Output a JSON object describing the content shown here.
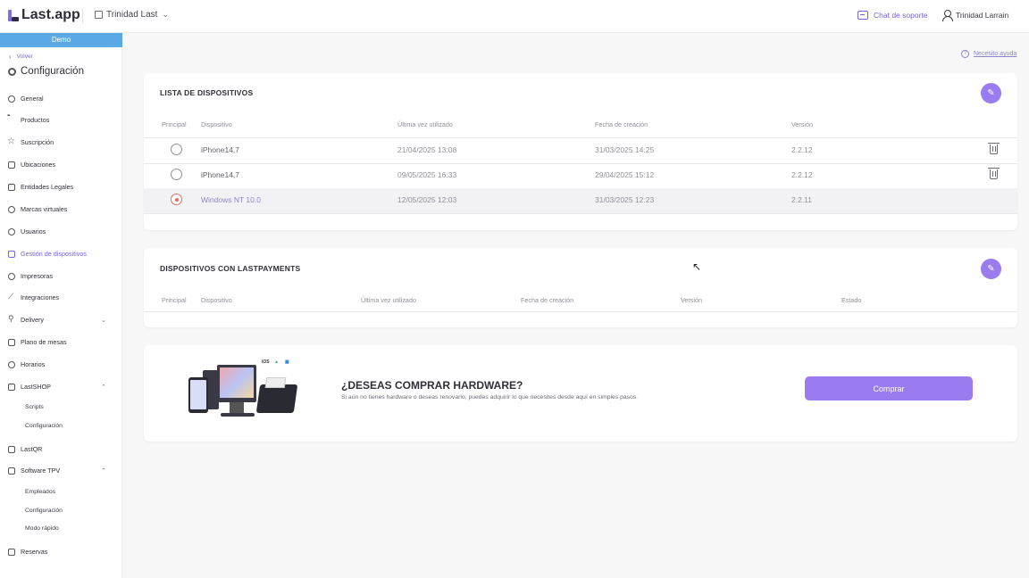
{
  "header": {
    "logo": "Last.app",
    "store": "Trinidad Last",
    "support": "Chat de soporte",
    "user": "Trinidad Larrain"
  },
  "sidebar": {
    "demo": "Demo",
    "back": "Volver",
    "title": "Configuración",
    "items": [
      {
        "label": "General",
        "icon": "gear-icon"
      },
      {
        "label": "Productos",
        "icon": "grid-icon"
      },
      {
        "label": "Suscripción",
        "icon": "star-icon"
      },
      {
        "label": "Ubicaciones",
        "icon": "store-icon"
      },
      {
        "label": "Entidades Legales",
        "icon": "document-icon"
      },
      {
        "label": "Marcas virtuales",
        "icon": "brand-icon"
      },
      {
        "label": "Usuarios",
        "icon": "user-icon"
      },
      {
        "label": "Gestión de dispositivos",
        "icon": "device-icon"
      },
      {
        "label": "Impresoras",
        "icon": "printer-icon"
      },
      {
        "label": "Integraciones",
        "icon": "plug-icon"
      },
      {
        "label": "Delivery",
        "icon": "bike-icon"
      },
      {
        "label": "Plano de mesas",
        "icon": "table-icon"
      },
      {
        "label": "Horarios",
        "icon": "clock-icon"
      },
      {
        "label": "LastSHOP",
        "icon": "shop-icon"
      },
      {
        "label": "LastQR",
        "icon": "qr-icon"
      },
      {
        "label": "Software TPV",
        "icon": "monitor-icon"
      },
      {
        "label": "Reservas",
        "icon": "calendar-icon"
      }
    ],
    "lastshop_sub": [
      "Scripts",
      "Configuración"
    ],
    "tpv_sub": [
      "Empleados",
      "Configuración",
      "Modo rápido"
    ]
  },
  "help": "Necesito ayuda",
  "devices": {
    "title": "LISTA DE DISPOSITIVOS",
    "columns": [
      "Principal",
      "Dispositivo",
      "Última vez utilizado",
      "Fecha de creación",
      "Versión"
    ],
    "rows": [
      {
        "device": "iPhone14,7",
        "last_used": "21/04/2025 13:08",
        "created": "31/03/2025 14:25",
        "version": "2.2.12",
        "principal": false
      },
      {
        "device": "iPhone14,7",
        "last_used": "09/05/2025 16:33",
        "created": "29/04/2025 15:12",
        "version": "2.2.12",
        "principal": false
      },
      {
        "device": "Windows NT 10.0",
        "last_used": "12/05/2025 12:03",
        "created": "31/03/2025 12:23",
        "version": "2.2.11",
        "principal": true
      }
    ]
  },
  "lastpayments": {
    "title": "DISPOSITIVOS CON LASTPAYMENTS",
    "columns": [
      "Principal",
      "Dispositivo",
      "Última vez utilizado",
      "Fecha de creación",
      "Versión",
      "Estado"
    ]
  },
  "hardware": {
    "title": "¿DESEAS COMPRAR HARDWARE?",
    "desc": "Si aún no tienes hardware o deseas renovarlo, puedes adquirir lo que necesites desde aquí en simples pasos.",
    "button": "Comprar",
    "os_label": "iOS"
  },
  "colors": {
    "accent": "#9a7cf0",
    "demo_bar": "#5aa9e6",
    "selected_radio": "#e46b6b"
  }
}
